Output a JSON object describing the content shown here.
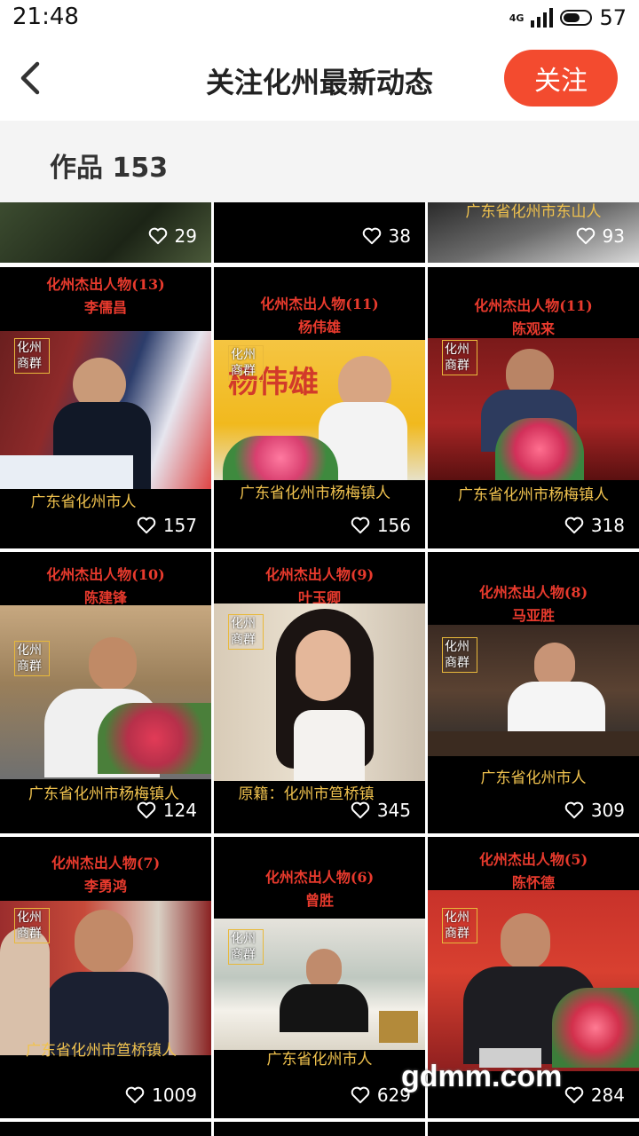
{
  "status": {
    "time": "21:48",
    "network": "4G",
    "battery": "57"
  },
  "header": {
    "title": "关注化州最新动态",
    "follow_label": "关注"
  },
  "works": {
    "label": "作品 153"
  },
  "badge_text": "化州商群",
  "top_row": [
    {
      "likes": "29"
    },
    {
      "likes": "38"
    },
    {
      "caption": "广东省化州市东山人",
      "likes": "93"
    }
  ],
  "cards": [
    {
      "title": "化州杰出人物(13)",
      "name": "李儒昌",
      "caption": "广东省化州市人",
      "likes": "157"
    },
    {
      "title": "化州杰出人物(11)",
      "name": "杨伟雄",
      "caption": "广东省化州市杨梅镇人",
      "likes": "156"
    },
    {
      "title": "化州杰出人物(11)",
      "name": "陈观来",
      "caption": "广东省化州市杨梅镇人",
      "likes": "318"
    },
    {
      "title": "化州杰出人物(10)",
      "name": "陈建锋",
      "caption": "广东省化州市杨梅镇人",
      "likes": "124"
    },
    {
      "title": "化州杰出人物(9)",
      "name": "叶玉卿",
      "caption": "原籍：化州市笪桥镇",
      "likes": "345"
    },
    {
      "title": "化州杰出人物(8)",
      "name": "马亚胜",
      "caption": "广东省化州市人",
      "likes": "309"
    },
    {
      "title": "化州杰出人物(7)",
      "name": "李勇鸿",
      "caption": "广东省化州市笪桥镇人",
      "likes": "1009"
    },
    {
      "title": "化州杰出人物(6)",
      "name": "曾胜",
      "caption": "广东省化州市人",
      "likes": "629"
    },
    {
      "title": "化州杰出人物(5)",
      "name": "陈怀德",
      "caption": "",
      "likes": "284"
    }
  ],
  "watermark": "gdmm.com",
  "colors": {
    "accent": "#f34b2f",
    "title_red": "#e83a2d",
    "caption_gold": "#f0c24e"
  }
}
